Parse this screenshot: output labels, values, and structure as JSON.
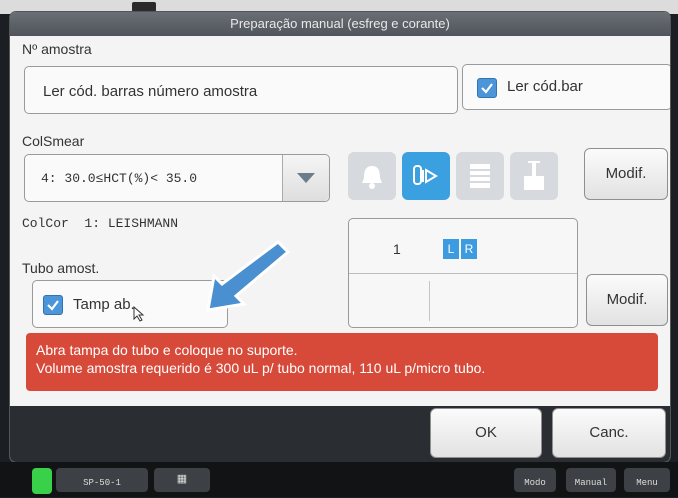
{
  "dialog": {
    "title": "Preparação manual (esfreg e corante)"
  },
  "sample": {
    "label": "Nº amostra",
    "input_value": "Ler cód. barras número amostra",
    "barcode_checkbox_label": "Ler cód.bar",
    "barcode_checked": true
  },
  "colsmear": {
    "label": "ColSmear",
    "selected": "4: 30.0≤HCT(%)< 35.0"
  },
  "colcor": {
    "text": "ColCor  1: LEISHMANN"
  },
  "tube": {
    "label": "Tubo amost.",
    "checkbox_label": "Tamp ab.",
    "checked": true
  },
  "mode_panel": {
    "value": "1",
    "left_badge": "L",
    "right_badge": "R"
  },
  "buttons": {
    "modify_top": "Modif.",
    "modify_bottom": "Modif.",
    "ok": "OK",
    "cancel": "Canc."
  },
  "alert": {
    "line1": "Abra tampa do tubo e coloque no suporte.",
    "line2": "Volume amostra requerido é 300 uL p/ tubo normal, 110 uL p/micro tubo."
  },
  "taskbar": {
    "left_item": "SP-50-1",
    "modo": "Modo",
    "manual": "Manual",
    "menu": "Menu"
  },
  "colors": {
    "accent_blue": "#3aa0df",
    "alert_red": "#d74a3a",
    "annotation_arrow": "#4a8fd0"
  }
}
